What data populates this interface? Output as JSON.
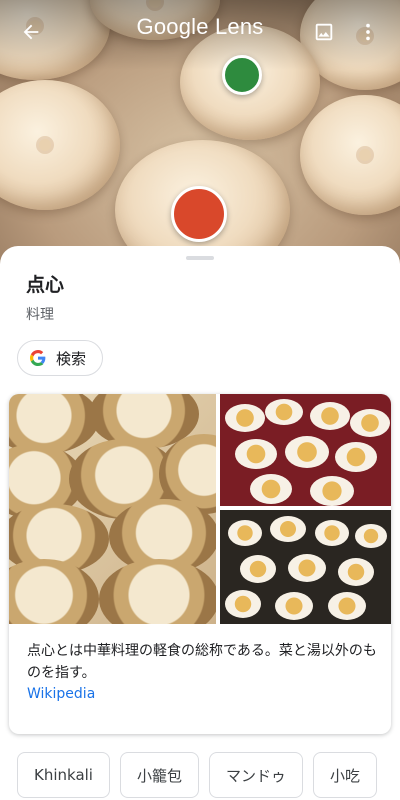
{
  "header": {
    "title": "Google Lens",
    "back_icon": "arrow-back-icon",
    "gallery_icon": "image-icon",
    "menu_icon": "more-vert-icon"
  },
  "colors": {
    "dot_green": "#2e8b3e",
    "dot_red": "#d9482b",
    "link": "#1a73e8"
  },
  "result": {
    "title": "点心",
    "category": "料理",
    "search_chip": {
      "label": "検索",
      "icon": "google-g-icon"
    },
    "description": "点心とは中華料理の軽食の総称である。菜と湯以外のものを指す。",
    "source": "Wikipedia"
  },
  "related_chips": [
    "Khinkali",
    "小籠包",
    "マンドゥ",
    "小吃"
  ]
}
